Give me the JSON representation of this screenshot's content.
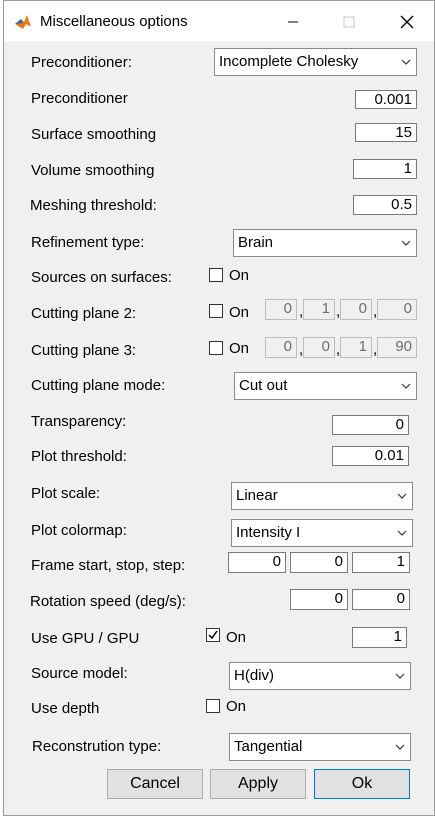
{
  "window": {
    "title": "Miscellaneous options"
  },
  "rows": {
    "preconditioner_select": {
      "label": "Preconditioner:",
      "value": "Incomplete Cholesky"
    },
    "preconditioner_value": {
      "label": "Preconditioner",
      "value": "0.001"
    },
    "surface_smoothing": {
      "label": "Surface smoothing",
      "value": "15"
    },
    "volume_smoothing": {
      "label": "Volume smoothing",
      "value": "1"
    },
    "meshing_threshold": {
      "label": "Meshing threshold:",
      "value": "0.5"
    },
    "refinement_type": {
      "label": "Refinement type:",
      "value": "Brain"
    },
    "sources_on_surfaces": {
      "label": "Sources on surfaces:",
      "checkbox_label": "On",
      "checked": false
    },
    "cutting_plane_2": {
      "label": "Cutting plane 2:",
      "checkbox_label": "On",
      "checked": false,
      "values": [
        "0",
        "1",
        "0",
        "0"
      ]
    },
    "cutting_plane_3": {
      "label": "Cutting plane 3:",
      "checkbox_label": "On",
      "checked": false,
      "values": [
        "0",
        "0",
        "1",
        "90"
      ]
    },
    "cutting_plane_mode": {
      "label": "Cutting plane mode:",
      "value": "Cut out"
    },
    "transparency": {
      "label": "Transparency:",
      "value": "0"
    },
    "plot_threshold": {
      "label": "Plot threshold:",
      "value": "0.01"
    },
    "plot_scale": {
      "label": "Plot scale:",
      "value": "Linear"
    },
    "plot_colormap": {
      "label": "Plot colormap:",
      "value": "Intensity I"
    },
    "frame": {
      "label": "Frame start, stop, step:",
      "values": [
        "0",
        "0",
        "1"
      ]
    },
    "rotation_speed": {
      "label": "Rotation speed (deg/s):",
      "values": [
        "0",
        "0"
      ]
    },
    "use_gpu": {
      "label": "Use GPU / GPU",
      "checkbox_label": "On",
      "checked": true,
      "value": "1"
    },
    "source_model": {
      "label": "Source model:",
      "value": "H(div)"
    },
    "use_depth": {
      "label": "Use depth",
      "checkbox_label": "On",
      "checked": false
    },
    "reconstruction_type": {
      "label": "Reconstrution type:",
      "value": "Tangential"
    }
  },
  "comma": ",",
  "buttons": {
    "cancel": "Cancel",
    "apply": "Apply",
    "ok": "Ok"
  },
  "colors": {
    "accent": "#0078d7",
    "matlab_icon": "#e8791a"
  },
  "icons": [
    "matlab-icon",
    "minimize-icon",
    "maximize-icon",
    "close-icon",
    "chevron-down-icon",
    "checkmark-icon"
  ]
}
